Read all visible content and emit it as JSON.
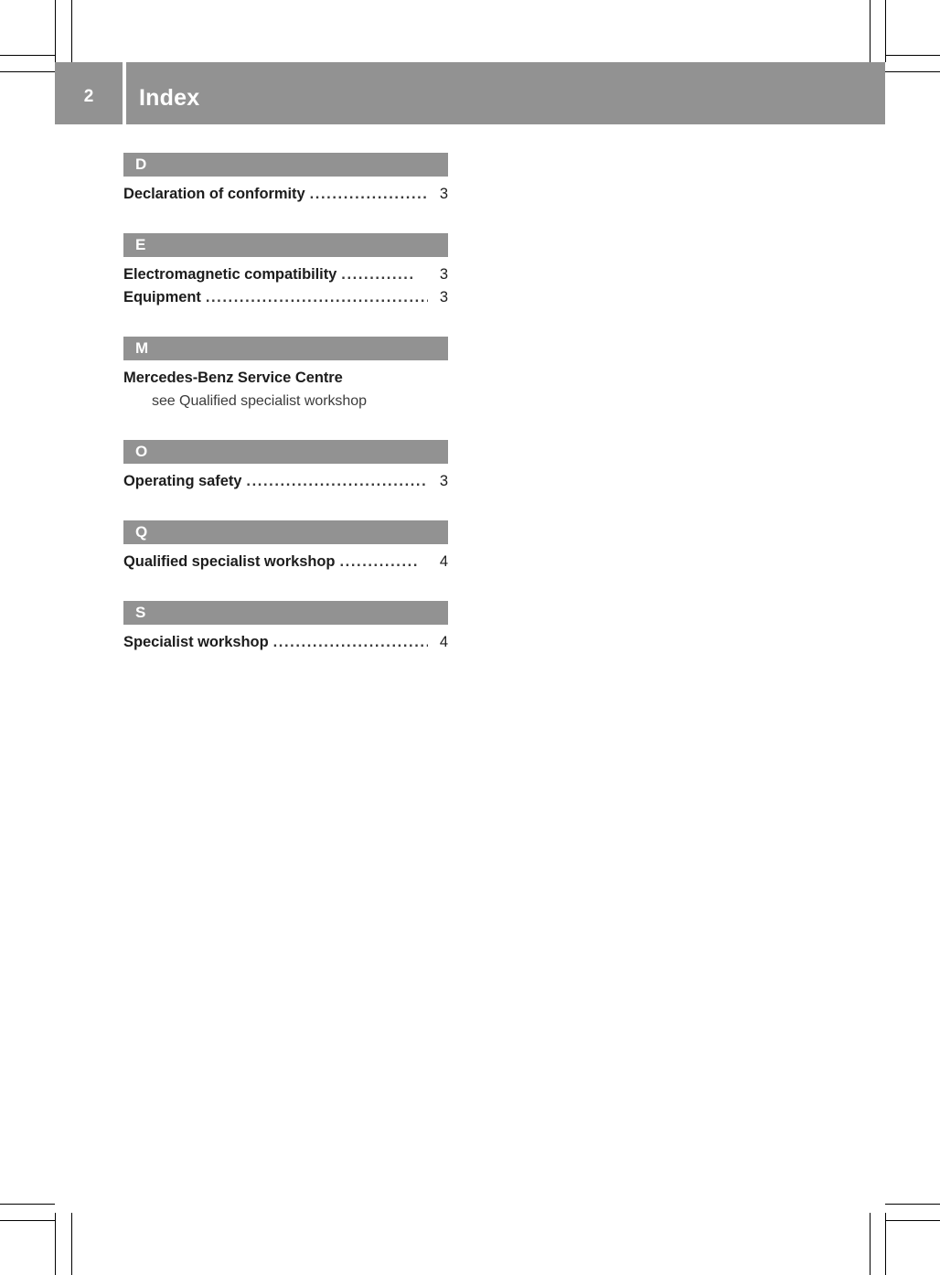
{
  "document": {
    "kind": "printed-manual-index-page",
    "accent_gray": "#929292",
    "text_color": "#1d1d1d",
    "background": "#ffffff"
  },
  "header": {
    "page_number": "2",
    "title": "Index"
  },
  "index": {
    "groups": [
      {
        "letter": "D",
        "entries": [
          {
            "label": "Declaration of conformity",
            "leader": "......................",
            "page": "3"
          }
        ]
      },
      {
        "letter": "E",
        "entries": [
          {
            "label": "Electromagnetic compatibility",
            "leader": ".............",
            "page": "3"
          },
          {
            "label": "Equipment",
            "leader": "...............................................",
            "page": "3"
          }
        ]
      },
      {
        "letter": "M",
        "entries": [
          {
            "label": "Mercedes-Benz Service Centre",
            "leader": "",
            "page": "",
            "subentry": "see Qualified specialist workshop"
          }
        ]
      },
      {
        "letter": "O",
        "entries": [
          {
            "label": "Operating safety",
            "leader": "......................................",
            "page": "3"
          }
        ]
      },
      {
        "letter": "Q",
        "entries": [
          {
            "label": "Qualified specialist workshop",
            "leader": "..............",
            "page": "4"
          }
        ]
      },
      {
        "letter": "S",
        "entries": [
          {
            "label": "Specialist workshop",
            "leader": "...............................",
            "page": "4"
          }
        ]
      }
    ]
  },
  "crop_marks": {
    "color": "#000000",
    "present": true
  }
}
